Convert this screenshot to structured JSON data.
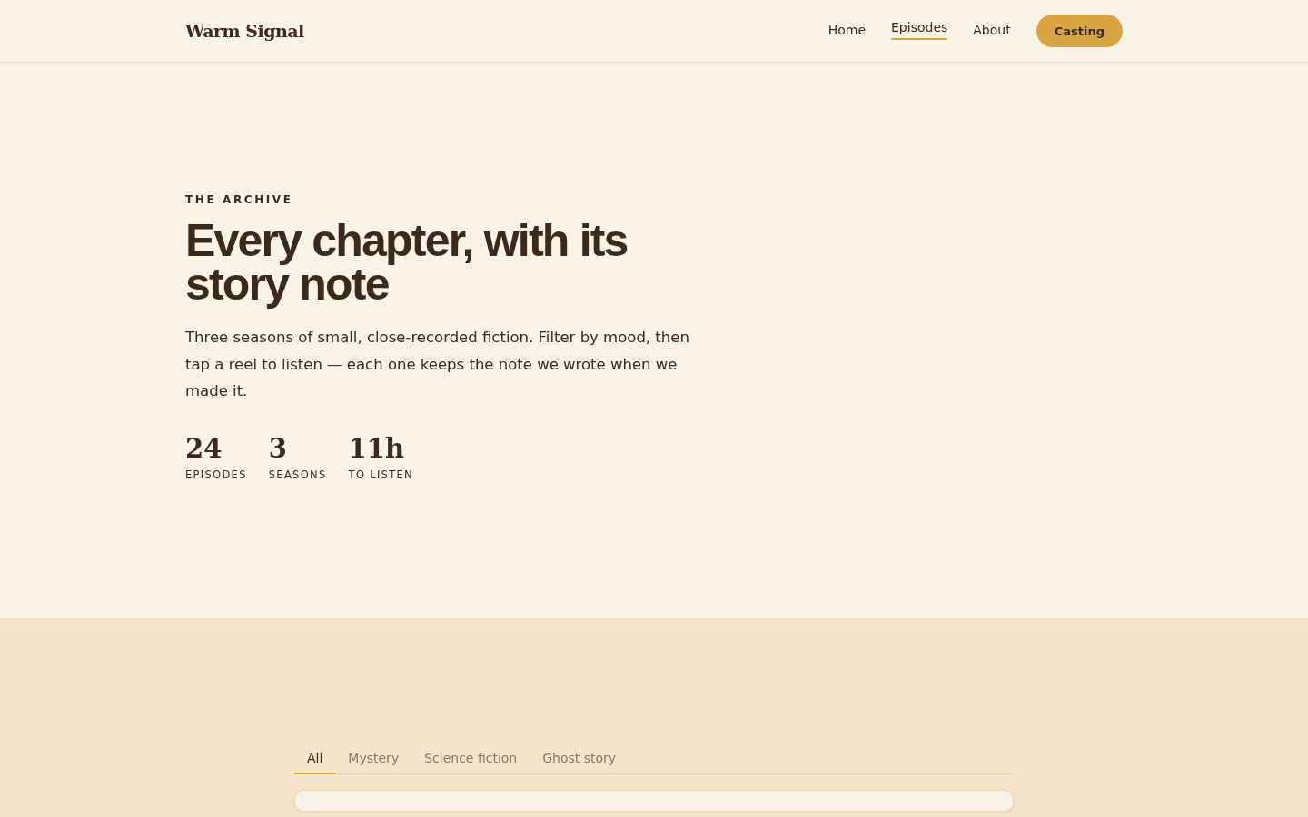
{
  "header": {
    "logo": "Warm Signal",
    "nav": [
      {
        "label": "Home",
        "selected": false
      },
      {
        "label": "Episodes",
        "selected": true
      },
      {
        "label": "About",
        "selected": false
      }
    ],
    "cta": "Casting"
  },
  "hero": {
    "eyebrow": "THE ARCHIVE",
    "title": "Every chapter, with its story note",
    "lead": "Three seasons of small, close-recorded fiction. Filter by mood, then tap a reel to listen — each one keeps the note we wrote when we made it.",
    "stats": [
      {
        "value": "24",
        "label": "EPISODES"
      },
      {
        "value": "3",
        "label": "SEASONS"
      },
      {
        "value": "11h",
        "label": "TO LISTEN"
      }
    ]
  },
  "filters": [
    {
      "label": "All",
      "selected": true
    },
    {
      "label": "Mystery",
      "selected": false
    },
    {
      "label": "Science fiction",
      "selected": false
    },
    {
      "label": "Ghost story",
      "selected": false
    }
  ]
}
